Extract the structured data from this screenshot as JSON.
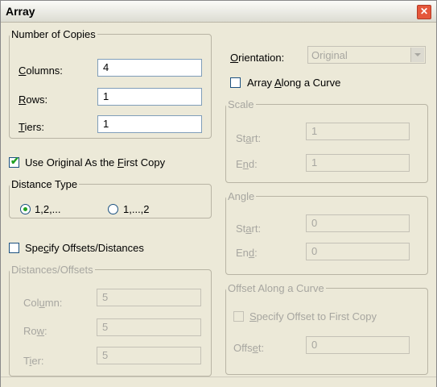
{
  "window": {
    "title": "Array",
    "close_glyph": "✕"
  },
  "copies": {
    "legend": "Number of Copies",
    "columns": {
      "pre": "",
      "u": "C",
      "post": "olumns:",
      "value": "4"
    },
    "rows": {
      "pre": "",
      "u": "R",
      "post": "ows:",
      "value": "1"
    },
    "tiers": {
      "pre": "",
      "u": "T",
      "post": "iers:",
      "value": "1"
    }
  },
  "use_original": {
    "pre": "Use Original As the ",
    "u": "F",
    "post": "irst Copy",
    "checked": true
  },
  "distance_type": {
    "legend": "Distance Type",
    "option1": "1,2,...",
    "option2": "1,...,2",
    "selected": "option1"
  },
  "specify_offsets": {
    "pre": "Spe",
    "u": "c",
    "post": "ify Offsets/Distances",
    "checked": false
  },
  "distances": {
    "legend": "Distances/Offsets",
    "column": {
      "pre": "Col",
      "u": "u",
      "post": "mn:",
      "value": "5"
    },
    "row": {
      "pre": "Ro",
      "u": "w",
      "post": ":",
      "value": "5"
    },
    "tier": {
      "pre": "T",
      "u": "i",
      "post": "er:",
      "value": "5"
    }
  },
  "orientation": {
    "pre": "",
    "u": "O",
    "post": "rientation:",
    "value": "Original"
  },
  "array_along_curve": {
    "pre": "Array ",
    "u": "A",
    "post": "long a Curve",
    "checked": false
  },
  "scale": {
    "legend": "Scale",
    "start": {
      "pre": "St",
      "u": "a",
      "post": "rt:",
      "value": "1"
    },
    "end": {
      "pre": "E",
      "u": "n",
      "post": "d:",
      "value": "1"
    }
  },
  "angle": {
    "legend": "Angle",
    "start": {
      "pre": "St",
      "u": "a",
      "post": "rt:",
      "value": "0"
    },
    "end": {
      "pre": "En",
      "u": "d",
      "post": ":",
      "value": "0"
    }
  },
  "offset_curve": {
    "legend": "Offset Along a Curve",
    "specify": {
      "pre": "",
      "u": "S",
      "post": "pecify Offset to First Copy",
      "checked": false
    },
    "offset": {
      "pre": "Offs",
      "u": "e",
      "post": "t:",
      "value": "0"
    }
  }
}
